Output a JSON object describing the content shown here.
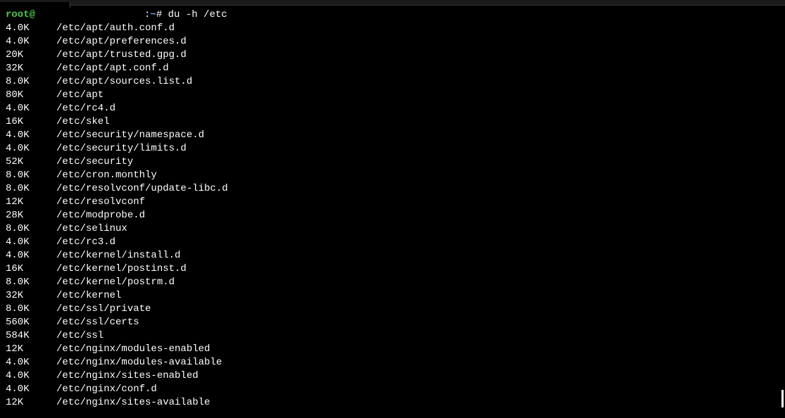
{
  "prompt": {
    "user": "root",
    "at": "@",
    "path": "~",
    "separator": ":",
    "symbol": "# ",
    "command": "du -h /etc"
  },
  "output": [
    {
      "size": "4.0K",
      "path": "/etc/apt/auth.conf.d"
    },
    {
      "size": "4.0K",
      "path": "/etc/apt/preferences.d"
    },
    {
      "size": "20K",
      "path": "/etc/apt/trusted.gpg.d"
    },
    {
      "size": "32K",
      "path": "/etc/apt/apt.conf.d"
    },
    {
      "size": "8.0K",
      "path": "/etc/apt/sources.list.d"
    },
    {
      "size": "80K",
      "path": "/etc/apt"
    },
    {
      "size": "4.0K",
      "path": "/etc/rc4.d"
    },
    {
      "size": "16K",
      "path": "/etc/skel"
    },
    {
      "size": "4.0K",
      "path": "/etc/security/namespace.d"
    },
    {
      "size": "4.0K",
      "path": "/etc/security/limits.d"
    },
    {
      "size": "52K",
      "path": "/etc/security"
    },
    {
      "size": "8.0K",
      "path": "/etc/cron.monthly"
    },
    {
      "size": "8.0K",
      "path": "/etc/resolvconf/update-libc.d"
    },
    {
      "size": "12K",
      "path": "/etc/resolvconf"
    },
    {
      "size": "28K",
      "path": "/etc/modprobe.d"
    },
    {
      "size": "8.0K",
      "path": "/etc/selinux"
    },
    {
      "size": "4.0K",
      "path": "/etc/rc3.d"
    },
    {
      "size": "4.0K",
      "path": "/etc/kernel/install.d"
    },
    {
      "size": "16K",
      "path": "/etc/kernel/postinst.d"
    },
    {
      "size": "8.0K",
      "path": "/etc/kernel/postrm.d"
    },
    {
      "size": "32K",
      "path": "/etc/kernel"
    },
    {
      "size": "8.0K",
      "path": "/etc/ssl/private"
    },
    {
      "size": "560K",
      "path": "/etc/ssl/certs"
    },
    {
      "size": "584K",
      "path": "/etc/ssl"
    },
    {
      "size": "12K",
      "path": "/etc/nginx/modules-enabled"
    },
    {
      "size": "4.0K",
      "path": "/etc/nginx/modules-available"
    },
    {
      "size": "4.0K",
      "path": "/etc/nginx/sites-enabled"
    },
    {
      "size": "4.0K",
      "path": "/etc/nginx/conf.d"
    },
    {
      "size": "12K",
      "path": "/etc/nginx/sites-available"
    }
  ]
}
